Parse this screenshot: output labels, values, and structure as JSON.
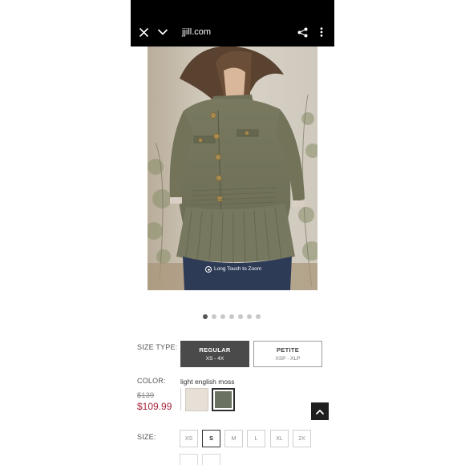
{
  "browser": {
    "url": "jjill.com",
    "close_icon": "close-icon",
    "collapse_icon": "chevron-down-icon",
    "share_icon": "share-icon",
    "menu_icon": "more-vertical-icon"
  },
  "product": {
    "image_alt": "Woman wearing an olive green peplum utility jacket with brass buttons",
    "zoom_hint": "Long Touch to Zoom",
    "carousel": {
      "total": 7,
      "active_index": 0
    }
  },
  "size_type": {
    "label": "SIZE TYPE:",
    "options": [
      {
        "name": "REGULAR",
        "range": "XS - 4X",
        "selected": true
      },
      {
        "name": "PETITE",
        "range": "XSP - XLP",
        "selected": false
      }
    ]
  },
  "color": {
    "label": "COLOR:",
    "selected_name": "light english moss",
    "swatches": [
      {
        "name": "cream",
        "hex": "#e6e0d6",
        "selected": false
      },
      {
        "name": "light english moss",
        "hex": "#6b7161",
        "selected": true
      }
    ]
  },
  "price": {
    "original": "$139",
    "sale": "$109.99"
  },
  "size": {
    "label": "SIZE:",
    "options": [
      "XS",
      "S",
      "M",
      "L",
      "XL",
      "2X"
    ],
    "selected": "S"
  },
  "colors": {
    "topbar": "#000000",
    "selected_button": "#4a4a4a",
    "sale_price": "#a8203a",
    "back_to_top": "#1f1f1f"
  }
}
